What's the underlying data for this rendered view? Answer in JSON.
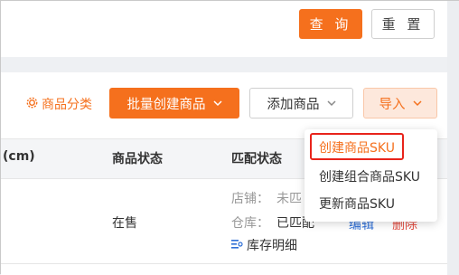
{
  "search": {
    "query_label": "查 询",
    "reset_label": "重 置"
  },
  "toolbar": {
    "category_label": "商品分类",
    "batch_create_label": "批量创建商品",
    "add_product_label": "添加商品",
    "import_label": "导入"
  },
  "table": {
    "headers": {
      "size": "(cm)",
      "status": "商品状态",
      "match_status": "匹配状态"
    },
    "row": {
      "status": "在售",
      "shop_label": "店铺：",
      "shop_value": "未匹",
      "warehouse_label": "仓库：",
      "warehouse_value": "已匹配",
      "inventory_label": "库存明细",
      "edit_label": "编辑",
      "delete_label": "删除"
    }
  },
  "import_menu": {
    "items": [
      {
        "label": "创建商品SKU",
        "active": true
      },
      {
        "label": "创建组合商品SKU",
        "active": false
      },
      {
        "label": "更新商品SKU",
        "active": false
      }
    ]
  },
  "colors": {
    "accent": "#f5701d",
    "highlight": "#e8241b",
    "link": "#2f6fd6",
    "danger": "#e34b3f"
  }
}
